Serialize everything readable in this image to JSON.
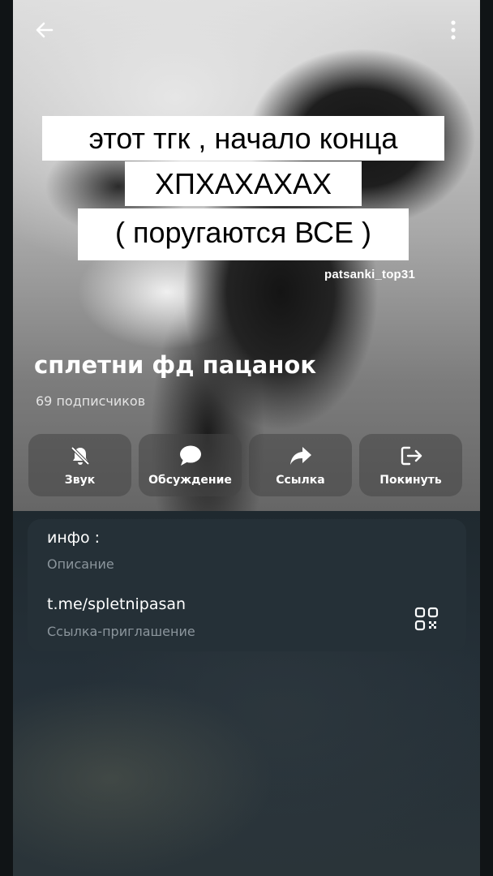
{
  "overlay_captions": {
    "line1": "этот тгк , начало конца",
    "line2": "ХПХАХАХАХ",
    "line3": "( поругаются ВСЕ )",
    "watermark": "patsanki_top31"
  },
  "channel": {
    "title": "сплетни фд пацанок",
    "subscribers": "69 подписчиков"
  },
  "actions": [
    {
      "label": "Звук",
      "icon": "bell-muted-icon"
    },
    {
      "label": "Обсуждение",
      "icon": "chat-bubble-icon"
    },
    {
      "label": "Ссылка",
      "icon": "share-arrow-icon"
    },
    {
      "label": "Покинуть",
      "icon": "leave-icon"
    }
  ],
  "info": {
    "description_value": "инфо :",
    "description_label": "Описание",
    "link_value": "t.me/spletnipasan",
    "link_label": "Ссылка-приглашение"
  },
  "colors": {
    "card_bg": "#253037",
    "caption_bg": "#ffffff",
    "muted_text": "#8b959c"
  }
}
